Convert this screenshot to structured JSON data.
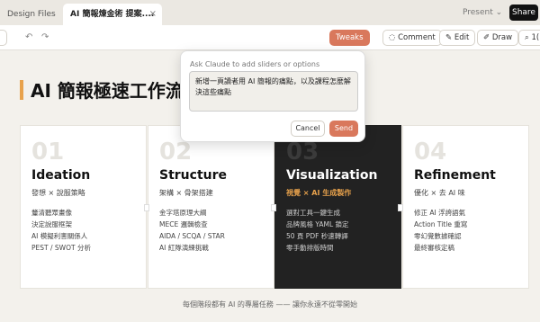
{
  "tabs": [
    {
      "label": "Design Files"
    },
    {
      "label": "AI 簡報煉金術 提案....",
      "close": "×"
    }
  ],
  "header": {
    "present_label": "Present ⌄",
    "share_label": "Share"
  },
  "toolbar": {
    "tweaks_label": "Tweaks",
    "comment_label": "Comment",
    "edit_label": "Edit",
    "draw_label": "Draw",
    "zoom_label": "1("
  },
  "slide": {
    "title": "AI 簡報極速工作流",
    "cards": [
      {
        "num": "01",
        "name": "Ideation",
        "sub": "發想 × 說服策略",
        "items": [
          "釐清聽眾畫像",
          "決定說服框架",
          "AI 模擬利害關係人",
          "PEST / SWOT 分析"
        ]
      },
      {
        "num": "02",
        "name": "Structure",
        "sub": "架構 × 骨架搭建",
        "items": [
          "金字塔原理大綱",
          "MECE 邏輯檢查",
          "AIDA / SCQA / STAR",
          "AI 紅隊演練挑戰"
        ]
      },
      {
        "num": "03",
        "name": "Visualization",
        "sub": "視覺 × AI 生成製作",
        "items": [
          "選對工具一鍵生成",
          "品牌風格 YAML 鎖定",
          "50 頁 PDF 秒速轉譯",
          "零手動排版時間"
        ]
      },
      {
        "num": "04",
        "name": "Refinement",
        "sub": "優化 × 去 AI 味",
        "items": [
          "修正 AI 浮誇語氣",
          "Action Title 重寫",
          "零幻覺數據確認",
          "最終審核定稿"
        ]
      }
    ],
    "footer": "每個階段都有 AI 的專屬任務 —— 讓你永遠不從零開始"
  },
  "popup": {
    "label": "Ask Claude to add sliders or options",
    "text": "新增一頁讀者用 AI 簡報的痛點，以及課程怎麼解決這些痛點",
    "cancel_label": "Cancel",
    "send_label": "Send"
  },
  "colors": {
    "accent": "#d9785c",
    "highlight": "#e8a24c",
    "dark_card": "#222222"
  }
}
